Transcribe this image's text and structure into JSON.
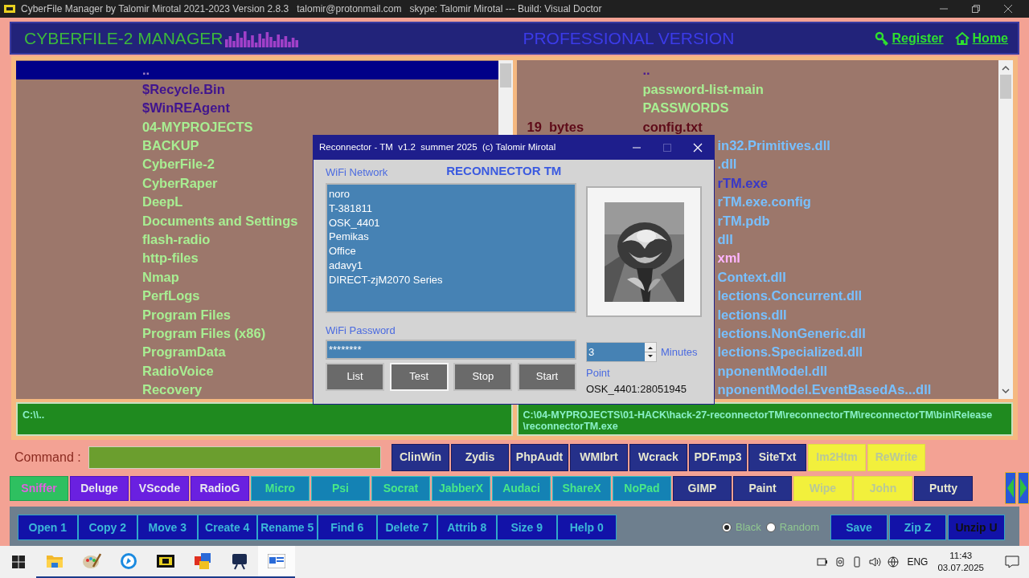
{
  "title_bar": {
    "title": "CyberFile Manager by Talomir Mirotal 2021-2023 Version 2.8.3   talomir@protonmail.com   skype: Talomir Mirotal --- Build: Visual Doctor"
  },
  "header": {
    "app_name": "CYBERFILE-2 MANAGER",
    "edition": "PROFESSIONAL VERSION",
    "links": [
      {
        "label": "Register",
        "kind": "register"
      },
      {
        "label": "Home",
        "kind": "home"
      }
    ]
  },
  "left_panel": {
    "items": [
      {
        "name": "..",
        "kind": "parent",
        "selected": true
      },
      {
        "name": "$Recycle.Bin",
        "kind": "system",
        "selected": false
      },
      {
        "name": "$WinREAgent",
        "kind": "system",
        "selected": false
      },
      {
        "name": "04-MYPROJECTS",
        "kind": "folder",
        "selected": false
      },
      {
        "name": "BACKUP",
        "kind": "folder",
        "selected": false
      },
      {
        "name": "CyberFile-2",
        "kind": "folder",
        "selected": false
      },
      {
        "name": "CyberRaper",
        "kind": "folder",
        "selected": false
      },
      {
        "name": "DeepL",
        "kind": "folder",
        "selected": false
      },
      {
        "name": "Documents and Settings",
        "kind": "folder",
        "selected": false
      },
      {
        "name": "flash-radio",
        "kind": "folder",
        "selected": false
      },
      {
        "name": "http-files",
        "kind": "folder",
        "selected": false
      },
      {
        "name": "Nmap",
        "kind": "folder",
        "selected": false
      },
      {
        "name": "PerfLogs",
        "kind": "folder",
        "selected": false
      },
      {
        "name": "Program Files",
        "kind": "folder",
        "selected": false
      },
      {
        "name": "Program Files (x86)",
        "kind": "folder",
        "selected": false
      },
      {
        "name": "ProgramData",
        "kind": "folder",
        "selected": false
      },
      {
        "name": "RadioVoice",
        "kind": "folder",
        "selected": false
      },
      {
        "name": "Recovery",
        "kind": "folder",
        "selected": false
      }
    ],
    "path": "C:\\\\.."
  },
  "right_panel": {
    "items": [
      {
        "name": "..",
        "kind": "parent",
        "selected": false
      },
      {
        "name": "password-list-main",
        "kind": "folder",
        "selected": false
      },
      {
        "name": "PASSWORDS",
        "kind": "folder",
        "selected": false
      },
      {
        "size": "19  bytes",
        "name": "config.txt",
        "kind": "file",
        "selected": false
      },
      {
        "name": "in32.Primitives.dll",
        "kind": "dll",
        "selected": false
      },
      {
        "name": ".dll",
        "kind": "dll",
        "selected": false
      },
      {
        "name": "rTM.exe",
        "kind": "exe",
        "selected": false
      },
      {
        "name": "rTM.exe.config",
        "kind": "dll",
        "selected": false
      },
      {
        "name": "rTM.pdb",
        "kind": "dll",
        "selected": false
      },
      {
        "name": "dll",
        "kind": "dll",
        "selected": false
      },
      {
        "name": "xml",
        "kind": "xml",
        "selected": false
      },
      {
        "name": "Context.dll",
        "kind": "dll",
        "selected": false
      },
      {
        "name": "lections.Concurrent.dll",
        "kind": "dll",
        "selected": false
      },
      {
        "name": "lections.dll",
        "kind": "dll",
        "selected": false
      },
      {
        "name": "lections.NonGeneric.dll",
        "kind": "dll",
        "selected": false
      },
      {
        "name": "lections.Specialized.dll",
        "kind": "dll",
        "selected": false
      },
      {
        "name": "nponentModel.dll",
        "kind": "dll",
        "selected": false
      },
      {
        "name": "nponentModel.EventBasedAs...dll",
        "kind": "dll",
        "selected": false
      }
    ],
    "path": "C:\\04-MYPROJECTS\\01-HACK\\hack-27-reconnectorTM\\reconnectorTM\\reconnectorTM\\bin\\Release\\reconnectorTM.exe"
  },
  "dialog": {
    "title": "Reconnector - TM  v1.2  summer 2025  (c) Talomir Mirotal",
    "heading": "RECONNECTOR TM",
    "network_label": "WiFi Network",
    "networks": [
      "noro",
      "T-381811",
      "OSK_4401",
      "Pemikas",
      "Office",
      "adavy1",
      "DIRECT-zjM2070 Series"
    ],
    "password_label": "WiFi Password",
    "password": "********",
    "buttons": [
      {
        "label": "List",
        "focused": false
      },
      {
        "label": "Test",
        "focused": true
      },
      {
        "label": "Stop",
        "focused": false
      },
      {
        "label": "Start",
        "focused": false
      }
    ],
    "interval": "3",
    "interval_unit": "Minutes",
    "point_label": "Point",
    "point": "OSK_4401:28051945"
  },
  "command": {
    "label": "Command :",
    "tools_row1": [
      {
        "label": "ClinWin",
        "kind": "navy"
      },
      {
        "label": "Zydis",
        "kind": "navy"
      },
      {
        "label": "PhpAudt",
        "kind": "navy"
      },
      {
        "label": "WMIbrt",
        "kind": "navy"
      },
      {
        "label": "Wcrack",
        "kind": "navy"
      },
      {
        "label": "PDF.mp3",
        "kind": "navy"
      },
      {
        "label": "SiteTxt",
        "kind": "navy"
      },
      {
        "label": "Im2Htm",
        "kind": "yellow"
      },
      {
        "label": "ReWrite",
        "kind": "yellow"
      }
    ],
    "tools_row2": [
      {
        "label": "Sniffer",
        "kind": "green"
      },
      {
        "label": "Deluge",
        "kind": "purple"
      },
      {
        "label": "VScode",
        "kind": "purple"
      },
      {
        "label": "RadioG",
        "kind": "purple"
      },
      {
        "label": "Micro",
        "kind": "teal"
      },
      {
        "label": "Psi",
        "kind": "teal"
      },
      {
        "label": "Socrat",
        "kind": "teal"
      },
      {
        "label": "JabberX",
        "kind": "teal"
      },
      {
        "label": "Audaci",
        "kind": "teal"
      },
      {
        "label": "ShareX",
        "kind": "teal"
      },
      {
        "label": "NoPad",
        "kind": "teal"
      },
      {
        "label": "GIMP",
        "kind": "navy"
      },
      {
        "label": "Paint",
        "kind": "navy"
      },
      {
        "label": "Wipe",
        "kind": "yellow"
      },
      {
        "label": "John",
        "kind": "yellow"
      },
      {
        "label": "Putty",
        "kind": "navy"
      }
    ]
  },
  "function_bar": {
    "functions": [
      "Open 1",
      "Copy 2",
      "Move 3",
      "Create 4",
      "Rename 5",
      "Find 6",
      "Delete 7",
      "Attrib 8",
      "Size 9",
      "Help 0"
    ],
    "modes": [
      {
        "label": "Black",
        "selected": true
      },
      {
        "label": "Random",
        "selected": false
      }
    ],
    "actions": [
      {
        "label": "Save",
        "kind": "light"
      },
      {
        "label": "Zip Z",
        "kind": "light"
      },
      {
        "label": "Unzip U",
        "kind": "dark"
      }
    ]
  },
  "taskbar": {
    "apps": [
      {
        "kind": "folder",
        "active": false
      },
      {
        "kind": "palette",
        "active": false
      },
      {
        "kind": "circle",
        "active": false
      },
      {
        "kind": "console",
        "active": false
      },
      {
        "kind": "tiles",
        "active": false
      },
      {
        "kind": "monitor",
        "active": false
      },
      {
        "kind": "window",
        "active": true
      }
    ],
    "language": "ENG",
    "time": "11:43",
    "date": "03.07.2025"
  }
}
